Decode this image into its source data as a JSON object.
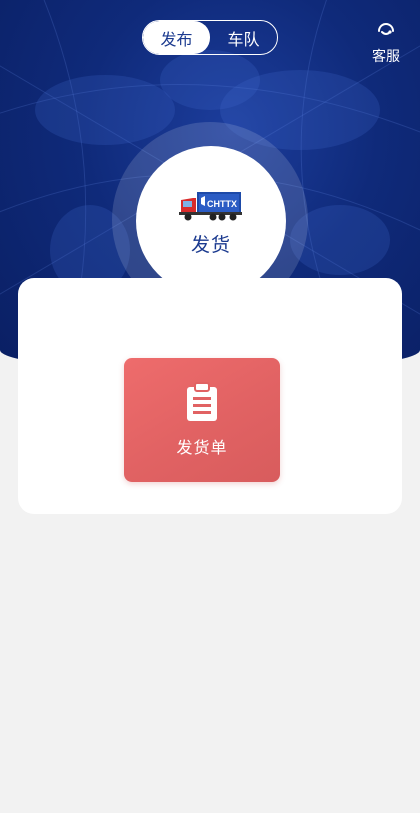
{
  "tabs": [
    {
      "label": "发布",
      "active": true
    },
    {
      "label": "车队",
      "active": false
    }
  ],
  "service": {
    "label": "客服",
    "icon": "headset-icon"
  },
  "hero": {
    "label": "发货",
    "icon": "truck-icon",
    "truck_logo_text": "CHTTX"
  },
  "actions": [
    {
      "label": "发货单",
      "icon": "clipboard-icon"
    }
  ],
  "colors": {
    "hero_blue": "#0f2a7a",
    "accent_text": "#1b3a8f",
    "tile_red": "#e16263",
    "background": "#f2f2f2"
  }
}
